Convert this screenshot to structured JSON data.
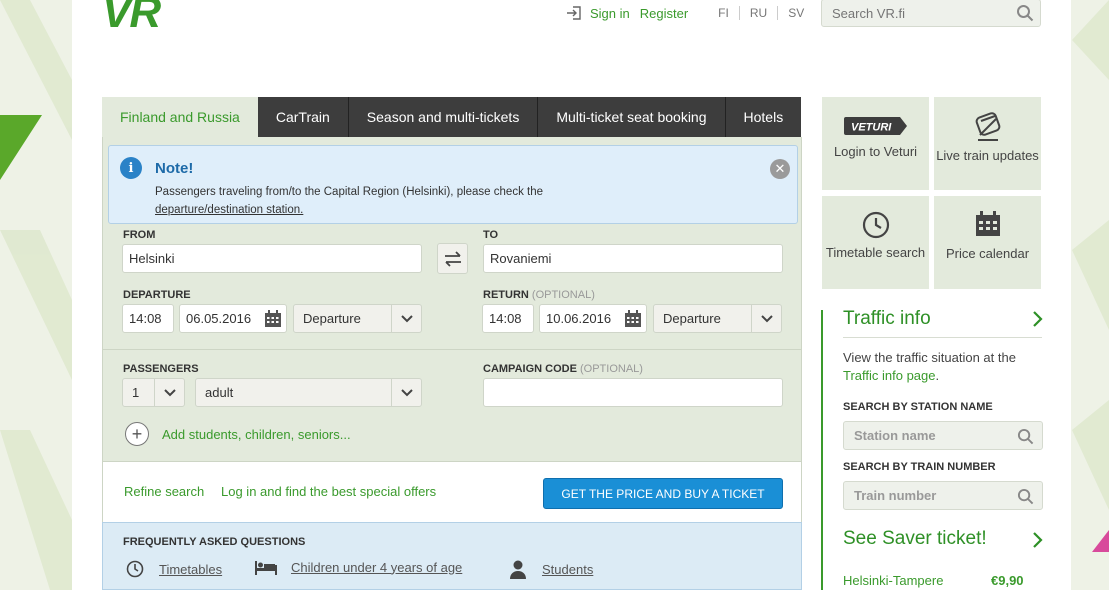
{
  "header": {
    "logo": "VR",
    "sign_in": "Sign in",
    "register": "Register",
    "languages": [
      "FI",
      "RU",
      "SV"
    ],
    "search_placeholder": "Search VR.fi"
  },
  "tabs": [
    {
      "label": "Finland and Russia",
      "active": true
    },
    {
      "label": "CarTrain",
      "active": false
    },
    {
      "label": "Season and multi-tickets",
      "active": false
    },
    {
      "label": "Multi-ticket seat booking",
      "active": false
    },
    {
      "label": "Hotels",
      "active": false
    }
  ],
  "note": {
    "title": "Note!",
    "text": "Passengers traveling from/to the Capital Region (Helsinki), please check the",
    "link": "departure/destination station."
  },
  "form": {
    "from_label": "FROM",
    "from_value": "Helsinki",
    "to_label": "TO",
    "to_value": "Rovaniemi",
    "departure_label": "DEPARTURE",
    "departure_time": "14:08",
    "departure_date": "06.05.2016",
    "departure_mode": "Departure",
    "return_label": "RETURN",
    "return_optional": "(OPTIONAL)",
    "return_time": "14:08",
    "return_date": "10.06.2016",
    "return_mode": "Departure",
    "passengers_label": "PASSENGERS",
    "passenger_count": "1",
    "passenger_type": "adult",
    "campaign_label": "CAMPAIGN CODE",
    "campaign_optional": "(OPTIONAL)",
    "campaign_value": "",
    "add_passengers": "Add students, children, seniors..."
  },
  "actions": {
    "refine": "Refine search",
    "login_offers": "Log in and find the best special offers",
    "cta": "GET THE PRICE AND BUY A TICKET"
  },
  "faq": {
    "title": "FREQUENTLY ASKED QUESTIONS",
    "items": [
      "Timetables",
      "Children under 4 years of age",
      "Students"
    ]
  },
  "sidebar": {
    "tiles": [
      {
        "label": "Login to Veturi",
        "icon": "veturi-logo-icon",
        "badge": "VETURI"
      },
      {
        "label": "Live train updates",
        "icon": "train-icon"
      },
      {
        "label": "Timetable search",
        "icon": "clock-icon"
      },
      {
        "label": "Price calendar",
        "icon": "calendar-icon"
      }
    ],
    "traffic_title": "Traffic info",
    "traffic_text": "View the traffic situation at the",
    "traffic_link": "Traffic info page",
    "traffic_end": ".",
    "station_label": "SEARCH BY STATION NAME",
    "station_placeholder": "Station name",
    "train_label": "SEARCH BY TRAIN NUMBER",
    "train_placeholder": "Train number",
    "saver_title": "See Saver ticket!",
    "saver_route": "Helsinki-Tampere",
    "saver_price": "€9,90"
  },
  "colors": {
    "brand_green": "#3a9a2c",
    "cta_blue": "#1a8fd6",
    "note_blue": "#dfeefa"
  }
}
